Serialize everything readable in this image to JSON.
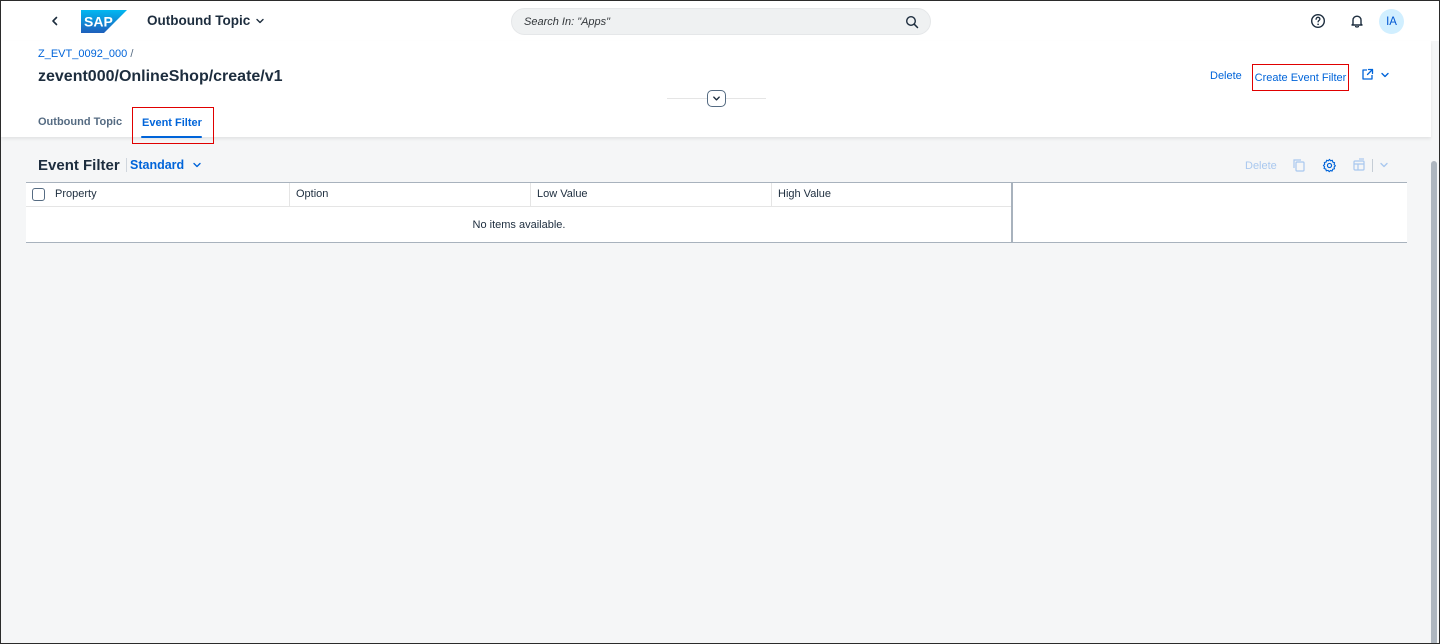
{
  "shell": {
    "app_title": "Outbound Topic",
    "search_placeholder": "Search In: \"Apps\"",
    "avatar_initials": "IA",
    "logo_text": "SAP"
  },
  "header": {
    "breadcrumb": "Z_EVT_0092_000",
    "breadcrumb_sep": "/",
    "title": "zevent000/OnlineShop/create/v1",
    "actions": {
      "delete": "Delete",
      "create_event_filter": "Create Event Filter"
    },
    "tabs": [
      {
        "label": "Outbound Topic",
        "selected": false
      },
      {
        "label": "Event Filter",
        "selected": true
      }
    ]
  },
  "table": {
    "title": "Event Filter",
    "variant": "Standard",
    "toolbar_delete": "Delete",
    "columns": [
      "Property",
      "Option",
      "Low Value",
      "High Value"
    ],
    "no_data": "No items available."
  },
  "colors": {
    "accent": "#0064d9",
    "highlight": "#e00000",
    "text": "#1d2d3e",
    "background": "#f5f6f7"
  }
}
